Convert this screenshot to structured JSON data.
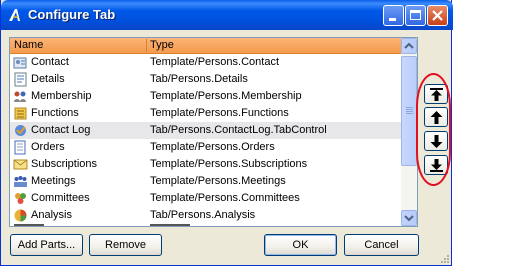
{
  "window": {
    "title": "Configure Tab"
  },
  "columns": {
    "name": "Name",
    "type": "Type"
  },
  "rows": [
    {
      "name": "Contact",
      "type": "Template/Persons.Contact",
      "icon": "contact-card-icon"
    },
    {
      "name": "Details",
      "type": "Tab/Persons.Details",
      "icon": "details-icon"
    },
    {
      "name": "Membership",
      "type": "Template/Persons.Membership",
      "icon": "membership-icon"
    },
    {
      "name": "Functions",
      "type": "Template/Persons.Functions",
      "icon": "functions-icon"
    },
    {
      "name": "Contact Log",
      "type": "Tab/Persons.ContactLog.TabControl",
      "icon": "contact-log-icon"
    },
    {
      "name": "Orders",
      "type": "Template/Persons.Orders",
      "icon": "orders-icon"
    },
    {
      "name": "Subscriptions",
      "type": "Template/Persons.Subscriptions",
      "icon": "subscriptions-icon"
    },
    {
      "name": "Meetings",
      "type": "Template/Persons.Meetings",
      "icon": "meetings-icon"
    },
    {
      "name": "Committees",
      "type": "Template/Persons.Committees",
      "icon": "committees-icon"
    },
    {
      "name": "Analysis",
      "type": "Tab/Persons.Analysis",
      "icon": "analysis-icon"
    }
  ],
  "selected_row": "Contact Log",
  "buttons": {
    "add_parts": "Add Parts...",
    "remove": "Remove",
    "ok": "OK",
    "cancel": "Cancel"
  },
  "side_buttons": [
    "move-to-top-icon",
    "move-up-icon",
    "move-down-icon",
    "move-to-bottom-icon"
  ],
  "colors": {
    "header": "#f7a55f",
    "title_bar": "#0058e8",
    "highlight_ring": "#e01020"
  }
}
